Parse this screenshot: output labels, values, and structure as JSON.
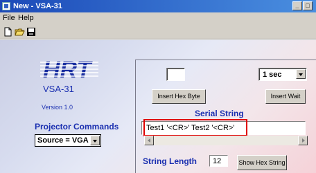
{
  "window": {
    "title": "New - VSA-31"
  },
  "menu": {
    "file": "File",
    "help": "Help"
  },
  "toolbar": {
    "new_icon": "new-document-icon",
    "open_icon": "open-folder-icon",
    "save_icon": "save-disk-icon"
  },
  "brand": {
    "logo_text": "HRT",
    "model": "VSA-31",
    "version": "Version 1.0"
  },
  "projector": {
    "label": "Projector Commands",
    "selected": "Source = VGA"
  },
  "serial": {
    "hex_value": "",
    "wait_value": "1  sec",
    "insert_hex_label": "Insert Hex Byte",
    "insert_wait_label": "Insert Wait",
    "section_label": "Serial String",
    "string_value": "Test1 '<CR>' Test2 '<CR>'",
    "length_label": "String Length",
    "length_value": "12",
    "show_hex_label": "Show Hex String"
  },
  "colors": {
    "label_blue": "#1a2fb0",
    "highlight_red": "#e00000",
    "logo_blue": "#1a2fa0"
  }
}
